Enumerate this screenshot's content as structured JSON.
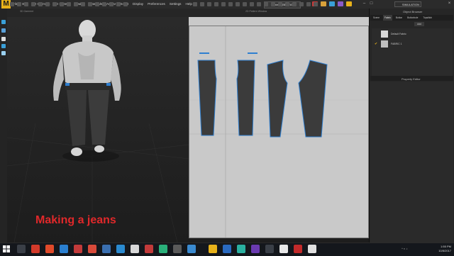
{
  "app": {
    "logo_letter": "M",
    "menu": [
      "File",
      "Edit",
      "3D Garment",
      "2D Pattern",
      "Sewing",
      "Materials",
      "Avatar",
      "Script",
      "Display",
      "Preferences",
      "Settings",
      "Help"
    ],
    "window_title": "Camera [BED7#3]",
    "mode_label": "SIMULATION",
    "accent_color": "#e8b21a"
  },
  "view3d": {
    "label": "3D Garment"
  },
  "view2d": {
    "label": "2D Pattern Window"
  },
  "object_browser": {
    "title": "Object Browser",
    "tabs": [
      "Scene",
      "Fabric",
      "Button",
      "Buttonhole",
      "Topstitch"
    ],
    "active_tab": "Fabric",
    "add_label": "Add",
    "items": [
      {
        "label": "Default Fabric",
        "selected": false
      },
      {
        "label": "FABRIC 1",
        "selected": true
      }
    ]
  },
  "property_editor": {
    "title": "Property Editor"
  },
  "caption": "Making a jeans",
  "taskbar": {
    "time": "1:55 PM",
    "date": "10/8/2017",
    "tray_text": "^ ◐ ♪"
  }
}
